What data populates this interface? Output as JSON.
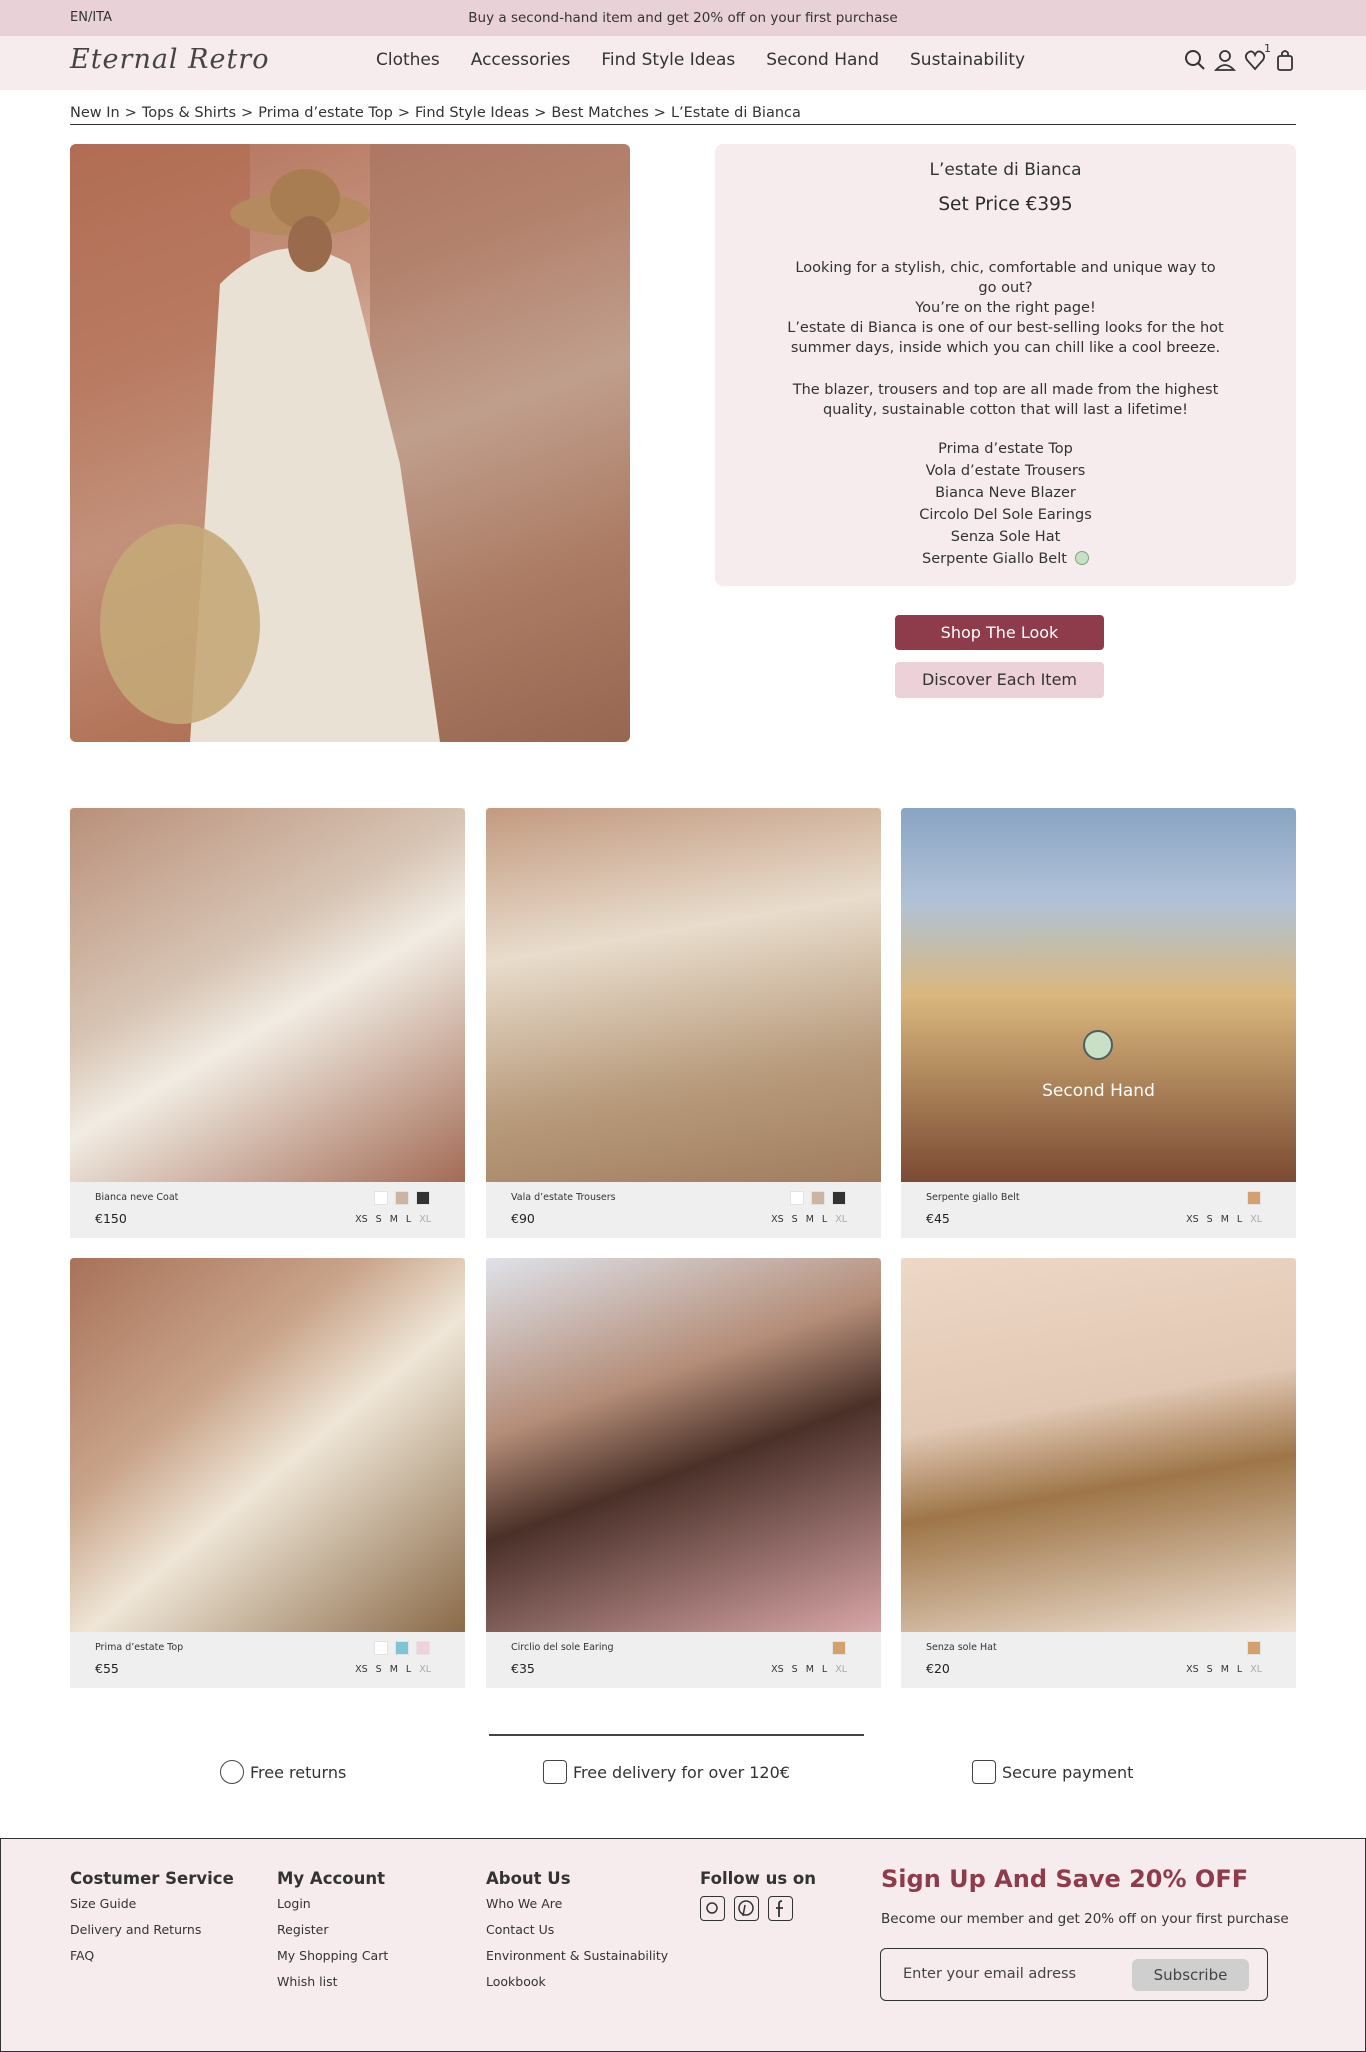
{
  "promo": {
    "lang": "EN/ITA",
    "message": "Buy a second-hand item and get 20% off on your first purchase"
  },
  "header": {
    "logo": "Eternal Retro",
    "nav": [
      "Clothes",
      "Accessories",
      "Find Style Ideas",
      "Second Hand",
      "Sustainability"
    ],
    "wishlist_count": "1",
    "icons": [
      "search-icon",
      "user-icon",
      "heart-icon",
      "bag-icon"
    ]
  },
  "breadcrumb": [
    "New In",
    "Tops & Shirts",
    "Prima d’estate Top",
    "Find Style Ideas",
    "Best Matches",
    "L’Estate di Bianca"
  ],
  "look": {
    "title": "L’estate di Bianca",
    "price": "Set Price  €395",
    "desc1": "Looking for a stylish, chic, comfortable and unique way to go out?",
    "desc2": "You’re on the right page!",
    "desc3": "L’estate di Bianca is one of our best-selling looks for the hot summer days, inside which you can chill like a cool breeze.",
    "desc4": "The blazer, trousers and top are all made from the highest quality, sustainable cotton that will last a lifetime!",
    "items": [
      "Prima d’estate Top",
      "Vola d’estate Trousers",
      "Bianca Neve Blazer",
      "Circolo Del Sole Earings",
      "Senza Sole Hat",
      "Serpente Giallo Belt"
    ]
  },
  "buttons": {
    "shop": "Shop The Look",
    "discover": "Discover Each Item"
  },
  "products": [
    {
      "name": "Bianca neve Coat",
      "price": "€150",
      "colors": [
        "#ffffff",
        "#cbb4a2",
        "#333333"
      ],
      "sizes": [
        "XS",
        "S",
        "M",
        "L",
        "XL"
      ]
    },
    {
      "name": "Vala d’estate Trousers",
      "price": "€90",
      "colors": [
        "#ffffff",
        "#cbb4a2",
        "#333333"
      ],
      "sizes": [
        "XS",
        "S",
        "M",
        "L",
        "XL"
      ]
    },
    {
      "name": "Serpente giallo Belt",
      "price": "€45",
      "colors": [
        "#d4a06d"
      ],
      "sizes": [
        "XS",
        "S",
        "M",
        "L",
        "XL"
      ],
      "badge": "Second Hand"
    },
    {
      "name": "Prima d’estate Top",
      "price": "€55",
      "colors": [
        "#ffffff",
        "#7fc3d9",
        "#efd1d9"
      ],
      "sizes": [
        "XS",
        "S",
        "M",
        "L",
        "XL"
      ]
    },
    {
      "name": "Circlio del sole Earing",
      "price": "€35",
      "colors": [
        "#d4a06d"
      ],
      "sizes": [
        "XS",
        "S",
        "M",
        "L",
        "XL"
      ]
    },
    {
      "name": "Senza sole Hat",
      "price": "€20",
      "colors": [
        "#d4a06d"
      ],
      "sizes": [
        "XS",
        "S",
        "M",
        "L",
        "XL"
      ]
    }
  ],
  "perks": [
    "Free returns",
    "Free delivery for over 120€",
    "Secure payment"
  ],
  "footer": {
    "customer": {
      "title": "Costumer Service",
      "links": [
        "Size Guide",
        "Delivery and Returns",
        "FAQ"
      ]
    },
    "account": {
      "title": "My Account",
      "links": [
        "Login",
        "Register",
        "My Shopping Cart",
        "Whish list"
      ]
    },
    "about": {
      "title": "About Us",
      "links": [
        "Who We Are",
        "Contact Us",
        "Environment & Sustainability",
        "Lookbook"
      ]
    },
    "follow": {
      "title": "Follow us on",
      "icons": [
        "instagram-icon",
        "pinterest-icon",
        "facebook-icon"
      ]
    },
    "signup": {
      "title": "Sign Up And Save 20% OFF",
      "subtitle": "Become our member and get 20% off on your first purchase",
      "placeholder": "Enter your email adress",
      "button": "Subscribe"
    }
  }
}
